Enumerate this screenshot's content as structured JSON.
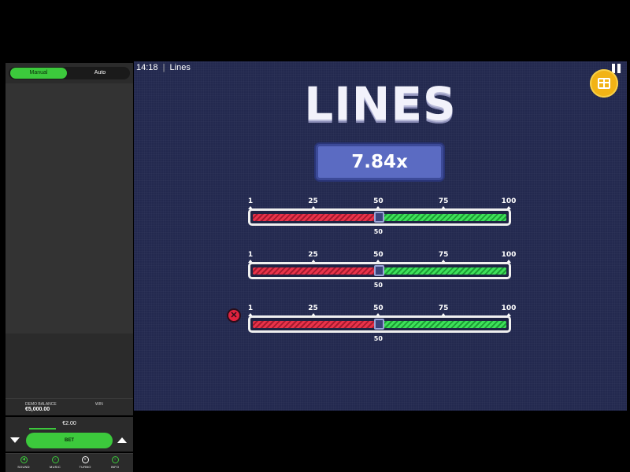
{
  "left_panel": {
    "modes": [
      {
        "label": "Manual",
        "active": true
      },
      {
        "label": "Auto",
        "active": false
      }
    ],
    "balance": {
      "label": "DEMO BALANCE",
      "value": "€5,000.00"
    },
    "win": {
      "label": "WIN"
    },
    "bet": {
      "amount": "€2.00",
      "button_label": "BET"
    },
    "bottom_bar": [
      {
        "icon": "sound-icon",
        "glyph": "🔊",
        "label": "SOUND"
      },
      {
        "icon": "music-icon",
        "glyph": "♪",
        "label": "MUSIC"
      },
      {
        "icon": "turbo-icon",
        "glyph": "⚡",
        "label": "TURBO"
      },
      {
        "icon": "info-icon",
        "glyph": "i",
        "label": "INFO"
      }
    ]
  },
  "game": {
    "time": "14:18",
    "separator": "|",
    "name": "Lines",
    "title": "LINES",
    "multiplier": "7.84x",
    "lines": [
      {
        "ticks": [
          "1",
          "25",
          "50",
          "75",
          "100"
        ],
        "value": "50",
        "removable": false
      },
      {
        "ticks": [
          "1",
          "25",
          "50",
          "75",
          "100"
        ],
        "value": "50",
        "removable": false
      },
      {
        "ticks": [
          "1",
          "25",
          "50",
          "75",
          "100"
        ],
        "value": "50",
        "removable": true
      }
    ],
    "colors": {
      "accent": "#3cc93c",
      "background": "#23294f",
      "red": "#e8334a",
      "green": "#3ee05a",
      "gift": "#f2b315"
    }
  }
}
